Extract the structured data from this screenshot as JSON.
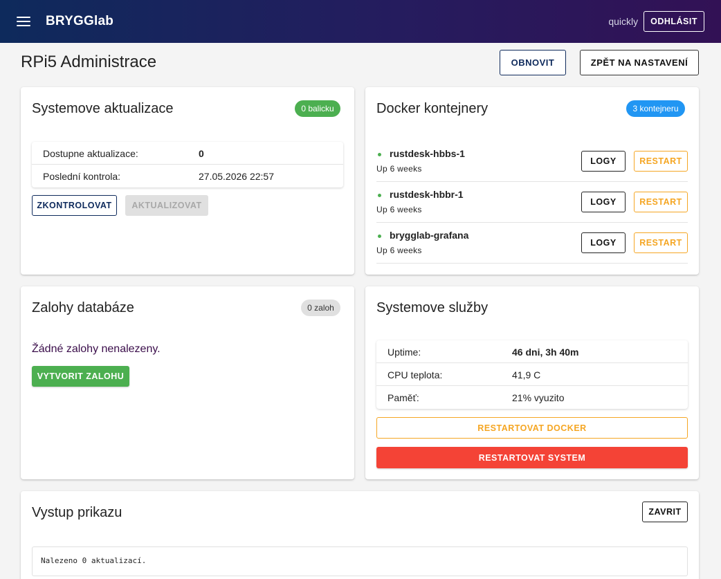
{
  "header": {
    "brand": "BRYGGlab",
    "username": "quickly",
    "logout_label": "ODHLÁSIT"
  },
  "page": {
    "title": "RPi5 Administrace",
    "refresh_label": "OBNOVIT",
    "back_label": "ZPĚT NA NASTAVENÍ"
  },
  "updates": {
    "title": "Systemove aktualizace",
    "badge": "0 balicku",
    "rows": [
      {
        "label": "Dostupne aktualizace:",
        "value": "0"
      },
      {
        "label": "Poslední kontrola:",
        "value": "27.05.2026 22:57"
      }
    ],
    "check_label": "ZKONTROLOVAT",
    "update_label": "AKTUALIZOVAT"
  },
  "docker": {
    "title": "Docker kontejnery",
    "badge": "3 kontejneru",
    "containers": [
      {
        "name": "rustdesk-hbbs-1",
        "status": "Up 6 weeks",
        "logs_label": "LOGY",
        "restart_label": "RESTART"
      },
      {
        "name": "rustdesk-hbbr-1",
        "status": "Up 6 weeks",
        "logs_label": "LOGY",
        "restart_label": "RESTART"
      },
      {
        "name": "brygglab-grafana",
        "status": "Up 6 weeks",
        "logs_label": "LOGY",
        "restart_label": "RESTART"
      }
    ]
  },
  "backups": {
    "title": "Zalohy databáze",
    "badge": "0 zaloh",
    "empty_message": "Žádné zalohy nenalezeny.",
    "create_label": "VYTVORIT ZALOHU"
  },
  "services": {
    "title": "Systemove služby",
    "rows": [
      {
        "label": "Uptime:",
        "value": "46 dni, 3h 40m"
      },
      {
        "label": "CPU teplota:",
        "value": "41,9 C"
      },
      {
        "label": "Paměť:",
        "value": "21% vyuzito"
      }
    ],
    "restart_docker_label": "RESTARTOVAT DOCKER",
    "restart_system_label": "RESTARTOVAT SYSTEM"
  },
  "output": {
    "title": "Vystup prikazu",
    "close_label": "ZAVRIT",
    "text": "Nalezeno 0 aktualizací."
  },
  "colors": {
    "header_gradient_start": "#0e2a5c",
    "header_gradient_end": "#321155",
    "success": "#4caf50",
    "info": "#2196f3",
    "warning": "#f5a623",
    "danger": "#f44336"
  },
  "icons": {
    "menu": "hamburger-menu-icon",
    "status": "status-dot-icon"
  }
}
